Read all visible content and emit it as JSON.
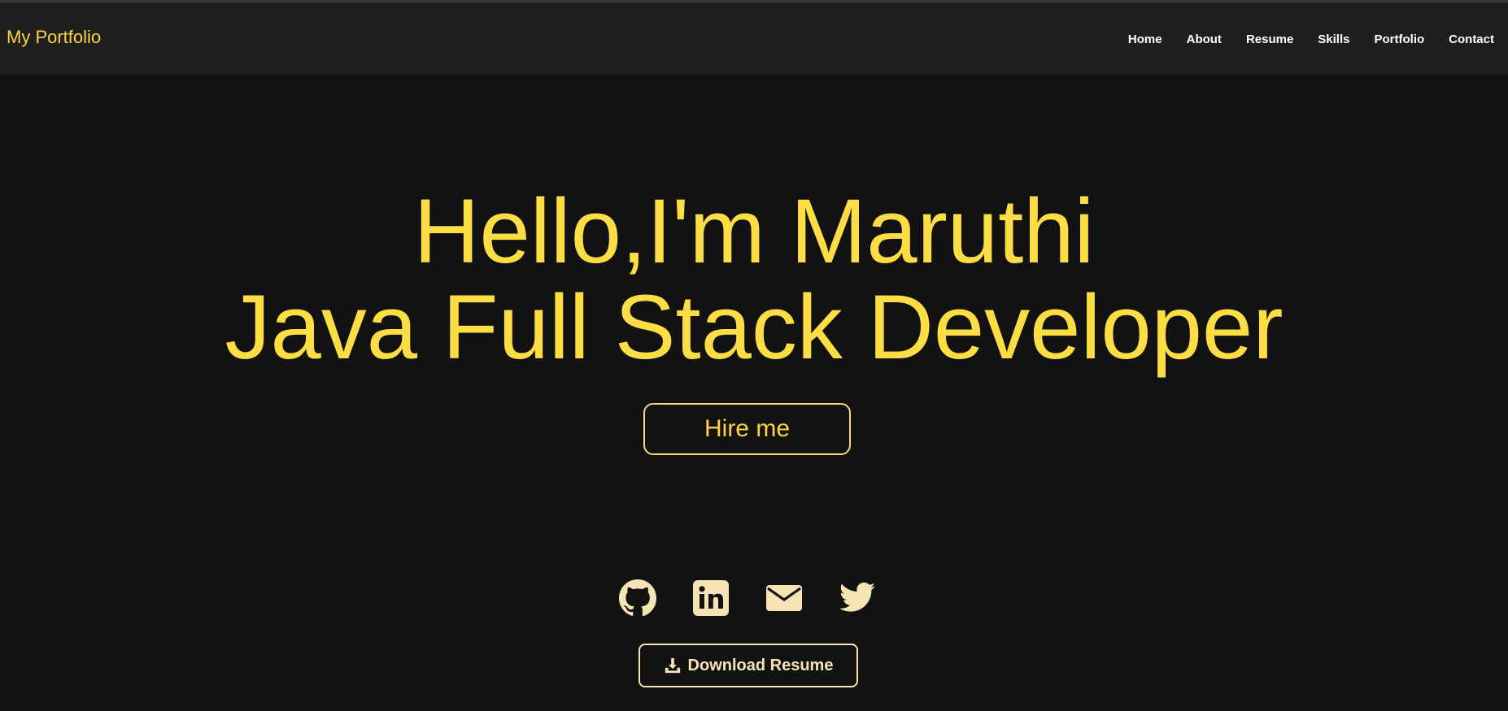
{
  "navbar": {
    "brand": "My Portfolio",
    "links": [
      {
        "label": "Home"
      },
      {
        "label": "About"
      },
      {
        "label": "Resume"
      },
      {
        "label": "Skills"
      },
      {
        "label": "Portfolio"
      },
      {
        "label": "Contact"
      }
    ]
  },
  "hero": {
    "greeting": "Hello,I'm Maruthi",
    "role": "Java Full Stack Developer",
    "hire_label": "Hire me"
  },
  "socials": [
    {
      "icon": "github-icon"
    },
    {
      "icon": "linkedin-icon"
    },
    {
      "icon": "email-icon"
    },
    {
      "icon": "twitter-icon"
    }
  ],
  "download": {
    "label": "Download Resume",
    "icon": "download-icon"
  },
  "colors": {
    "background": "#121212",
    "navbar": "#1f1f1f",
    "accent": "#fcd43f",
    "icon_cream": "#f7e4b5"
  }
}
